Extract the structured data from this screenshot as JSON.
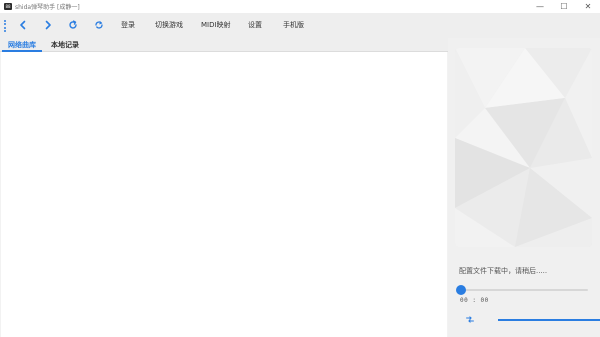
{
  "window": {
    "logo_text": "88",
    "title": "shida弹琴助手  [成静一]",
    "minimize": "—",
    "maximize": "☐",
    "close": "✕"
  },
  "toolbar": {
    "icons": [
      "back-icon",
      "forward-icon",
      "refresh-icon",
      "sync-icon"
    ],
    "menu": {
      "login": "登录",
      "switch_game": "切换游戏",
      "midi_mapping": "MIDI映射",
      "settings": "设置",
      "mobile": "手机版"
    }
  },
  "tabs": {
    "online": "网络曲库",
    "local": "本地记录"
  },
  "player": {
    "status": "配置文件下载中，请稍后.....",
    "time": "00 : 00",
    "seek_fraction": 0.0,
    "progress_fraction": 1.0
  },
  "colors": {
    "accent": "#2a7de1"
  }
}
